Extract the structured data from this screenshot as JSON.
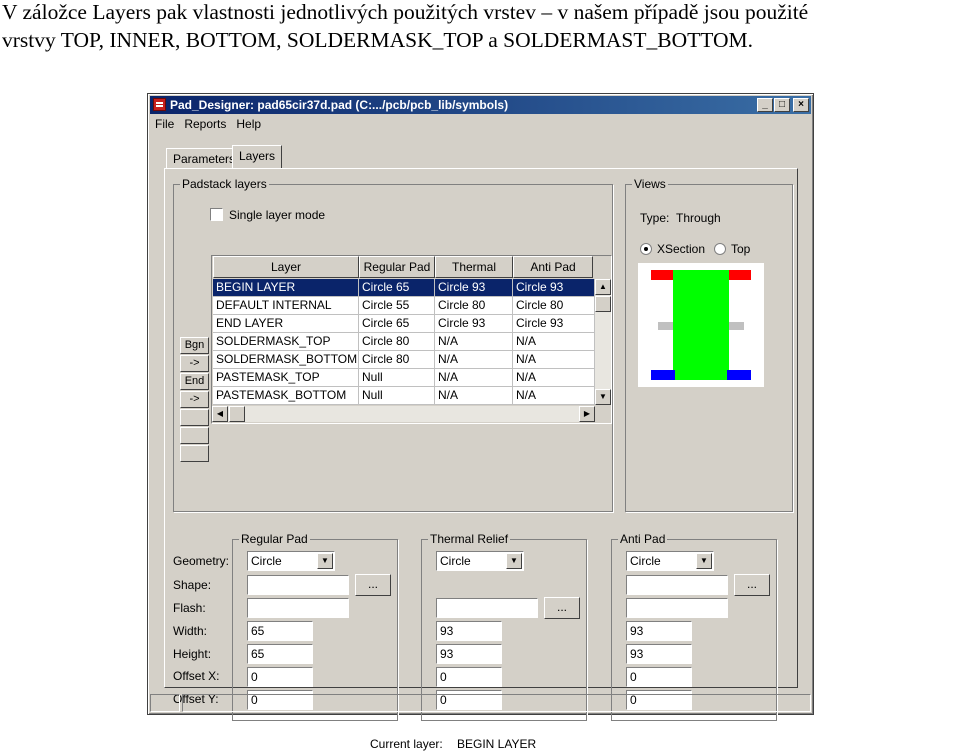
{
  "caption": {
    "line1": "V záložce Layers pak vlastnosti jednotlivých použitých vrstev – v našem případě jsou použité",
    "line2": "vrstvy TOP, INNER, BOTTOM, SOLDERMASK_TOP a SOLDERMAST_BOTTOM."
  },
  "window": {
    "title": "Pad_Designer: pad65cir37d.pad (C:.../pcb/pcb_lib/symbols)",
    "controls": {
      "minimize": "_",
      "maximize": "□",
      "close": "×"
    }
  },
  "menu": [
    "File",
    "Reports",
    "Help"
  ],
  "tabs": [
    "Parameters",
    "Layers"
  ],
  "active_tab": "Layers",
  "padstack_layers": {
    "group_label": "Padstack layers",
    "single_layer_mode_label": "Single layer mode",
    "single_layer_mode_checked": false,
    "columns": [
      "Layer",
      "Regular Pad",
      "Thermal Relief",
      "Anti Pad"
    ],
    "row_buttons": [
      "Bgn",
      "->",
      "End",
      "->",
      "",
      "",
      "",
      ""
    ],
    "rows": [
      {
        "layer": "BEGIN LAYER",
        "regular": "Circle 65",
        "thermal": "Circle 93",
        "anti": "Circle 93"
      },
      {
        "layer": "DEFAULT INTERNAL",
        "regular": "Circle 55",
        "thermal": "Circle 80",
        "anti": "Circle 80"
      },
      {
        "layer": "END LAYER",
        "regular": "Circle 65",
        "thermal": "Circle 93",
        "anti": "Circle 93"
      },
      {
        "layer": "SOLDERMASK_TOP",
        "regular": "Circle 80",
        "thermal": "N/A",
        "anti": "N/A"
      },
      {
        "layer": "SOLDERMASK_BOTTOM",
        "regular": "Circle 80",
        "thermal": "N/A",
        "anti": "N/A"
      },
      {
        "layer": "PASTEMASK_TOP",
        "regular": "Null",
        "thermal": "N/A",
        "anti": "N/A"
      },
      {
        "layer": "PASTEMASK_BOTTOM",
        "regular": "Null",
        "thermal": "N/A",
        "anti": "N/A"
      }
    ],
    "selected_row": 0
  },
  "views": {
    "group_label": "Views",
    "type_label": "Type:",
    "type_value": "Through",
    "radio_xsection": "XSection",
    "radio_top": "Top",
    "selected": "XSection",
    "colors": {
      "top_pad": "#ff0000",
      "bottom_pad": "#0000ff",
      "drill": "#00ff00",
      "inner": "#c0c0c0"
    }
  },
  "row_labels": {
    "geometry": "Geometry:",
    "shape": "Shape:",
    "flash": "Flash:",
    "width": "Width:",
    "height": "Height:",
    "offset_x": "Offset X:",
    "offset_y": "Offset Y:"
  },
  "regular_pad": {
    "label": "Regular Pad",
    "geometry": "Circle",
    "shape": "",
    "flash": "",
    "width": "65",
    "height": "65",
    "offset_x": "0",
    "offset_y": "0"
  },
  "thermal_relief": {
    "label": "Thermal Relief",
    "geometry": "Circle",
    "shape": "",
    "flash": "",
    "width": "93",
    "height": "93",
    "offset_x": "0",
    "offset_y": "0"
  },
  "anti_pad": {
    "label": "Anti Pad",
    "geometry": "Circle",
    "shape": "",
    "flash": "",
    "width": "93",
    "height": "93",
    "offset_x": "0",
    "offset_y": "0"
  },
  "browse_label": "...",
  "current_layer": {
    "label": "Current layer:",
    "value": "BEGIN LAYER"
  }
}
